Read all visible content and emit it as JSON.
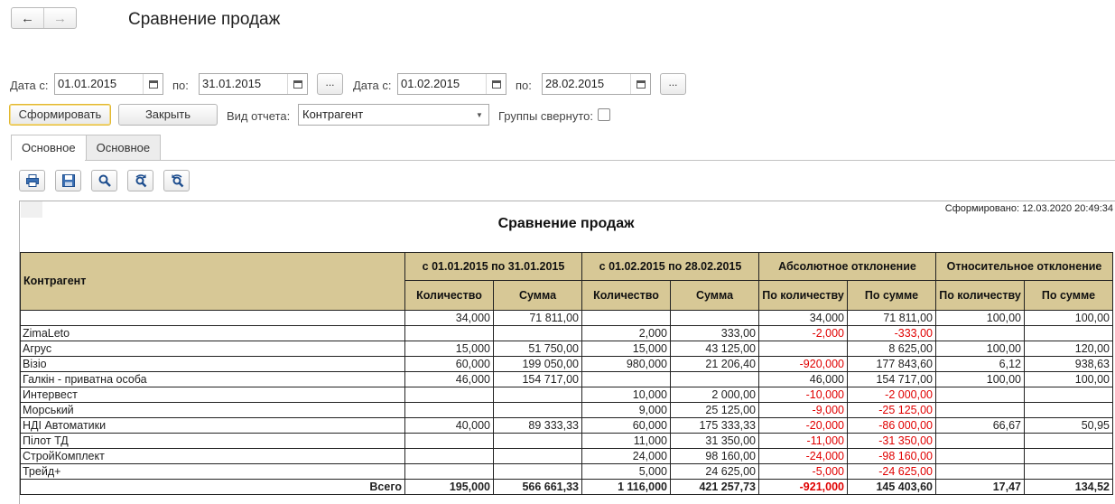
{
  "window": {
    "title": "Сравнение продаж",
    "back_icon": "←",
    "forward_icon": "→"
  },
  "filters": {
    "date_from_label_1": "Дата с:",
    "date_from_1": "01.01.2015",
    "to_label_1": "по:",
    "date_to_1": "31.01.2015",
    "period_btn_1": "...",
    "date_from_label_2": "Дата с:",
    "date_from_2": "01.02.2015",
    "to_label_2": "по:",
    "date_to_2": "28.02.2015",
    "period_btn_2": "..."
  },
  "actions": {
    "generate": "Сформировать",
    "close": "Закрыть",
    "report_type_label": "Вид отчета:",
    "report_type_value": "Контрагент",
    "groups_label": "Группы свернуто:"
  },
  "tabs": [
    {
      "label": "Основное"
    },
    {
      "label": "Основное"
    }
  ],
  "report": {
    "generated": "Сформировано: 12.03.2020 20:49:34",
    "title": "Сравнение продаж",
    "headers": {
      "counterparty": "Контрагент",
      "period1": "с 01.01.2015 по 31.01.2015",
      "period2": "с 01.02.2015 по 28.02.2015",
      "abs": "Абсолютное отклонение",
      "rel": "Относительное отклонение",
      "qty": "Количество",
      "sum": "Сумма",
      "by_qty": "По количеству",
      "by_sum": "По сумме"
    },
    "rows": [
      {
        "name": "",
        "c": [
          "34,000",
          "71 811,00",
          "",
          "",
          "34,000",
          "71 811,00",
          "100,00",
          "100,00"
        ]
      },
      {
        "name": "ZimaLeto",
        "c": [
          "",
          "",
          "2,000",
          "333,00",
          "-2,000",
          "-333,00",
          "",
          ""
        ]
      },
      {
        "name": "Агрус",
        "c": [
          "15,000",
          "51 750,00",
          "15,000",
          "43 125,00",
          "",
          "8 625,00",
          "100,00",
          "120,00"
        ]
      },
      {
        "name": "Візіо",
        "c": [
          "60,000",
          "199 050,00",
          "980,000",
          "21 206,40",
          "-920,000",
          "177 843,60",
          "6,12",
          "938,63"
        ]
      },
      {
        "name": "Галкін - приватна особа",
        "c": [
          "46,000",
          "154 717,00",
          "",
          "",
          "46,000",
          "154 717,00",
          "100,00",
          "100,00"
        ]
      },
      {
        "name": "Интервест",
        "c": [
          "",
          "",
          "10,000",
          "2 000,00",
          "-10,000",
          "-2 000,00",
          "",
          ""
        ]
      },
      {
        "name": "Морський",
        "c": [
          "",
          "",
          "9,000",
          "25 125,00",
          "-9,000",
          "-25 125,00",
          "",
          ""
        ]
      },
      {
        "name": "НДІ Автоматики",
        "c": [
          "40,000",
          "89 333,33",
          "60,000",
          "175 333,33",
          "-20,000",
          "-86 000,00",
          "66,67",
          "50,95"
        ]
      },
      {
        "name": "Пілот ТД",
        "c": [
          "",
          "",
          "11,000",
          "31 350,00",
          "-11,000",
          "-31 350,00",
          "",
          ""
        ]
      },
      {
        "name": "СтройКомплект",
        "c": [
          "",
          "",
          "24,000",
          "98 160,00",
          "-24,000",
          "-98 160,00",
          "",
          ""
        ]
      },
      {
        "name": "Трейд+",
        "c": [
          "",
          "",
          "5,000",
          "24 625,00",
          "-5,000",
          "-24 625,00",
          "",
          ""
        ]
      }
    ],
    "total": {
      "name": "Всего",
      "c": [
        "195,000",
        "566 661,33",
        "1 116,000",
        "421 257,73",
        "-921,000",
        "145 403,60",
        "17,47",
        "134,52"
      ]
    }
  },
  "colors": {
    "header_bg": "#d7c896",
    "negative": "#e00000",
    "primary_border": "#e2b830"
  }
}
